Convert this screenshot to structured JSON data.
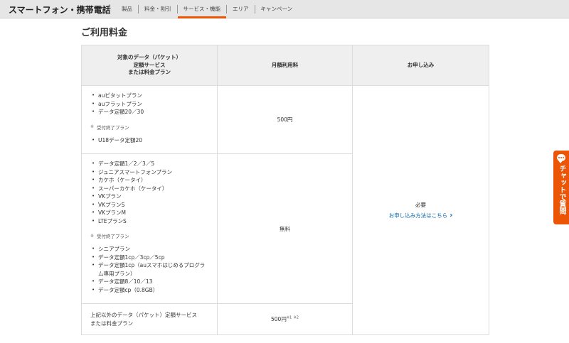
{
  "header": {
    "brand": "スマートフォン・携帯電話",
    "nav": [
      {
        "label": "製品"
      },
      {
        "label": "料金・割引"
      },
      {
        "label": "サービス・機能"
      },
      {
        "label": "エリア"
      },
      {
        "label": "キャンペーン"
      }
    ],
    "active_nav": "サービス・機能",
    "accent_color": "#eb5505"
  },
  "page_title": "ご利用料金",
  "table": {
    "headers": {
      "col1": [
        "対象のデータ（パケット）",
        "定額サービス",
        "または料金プラン"
      ],
      "col2": "月額利用料",
      "col3": "お申し込み"
    },
    "rows": [
      {
        "plans": [
          "auピタットプラン",
          "auフラットプラン",
          "データ定額20／30"
        ],
        "closed_label": "受付終了プラン",
        "closed_plans": [
          "U18データ定額20"
        ],
        "fee": "500円"
      },
      {
        "plans": [
          "データ定額1／2／3／5",
          "ジュニアスマートフォンプラン",
          "カケホ（ケータイ）",
          "スーパーカケホ（ケータイ）",
          "VKプラン",
          "VKプランS",
          "VKプランM",
          "LTEプランS"
        ],
        "closed_label": "受付終了プラン",
        "closed_plans": [
          "シニアプラン",
          "データ定額1cp／3cp／5cp",
          "データ定額1cp（auスマホはじめるプログラム専用プラン）",
          "データ定額8／10／13",
          "データ定額cp（0.8GB）"
        ],
        "fee": "無料"
      },
      {
        "text": [
          "上記以外のデータ（パケット）定額サービス",
          "または料金プラン"
        ],
        "fee": "500円",
        "fee_notes": [
          "※1",
          "※2"
        ]
      }
    ],
    "application": {
      "status": "必要",
      "link": "お申し込み方法はこちら",
      "link_color": "#0066b3"
    }
  },
  "chat": {
    "label": "チャットで質問",
    "icon": "chat-bubble-icon"
  },
  "note_mark": "※"
}
